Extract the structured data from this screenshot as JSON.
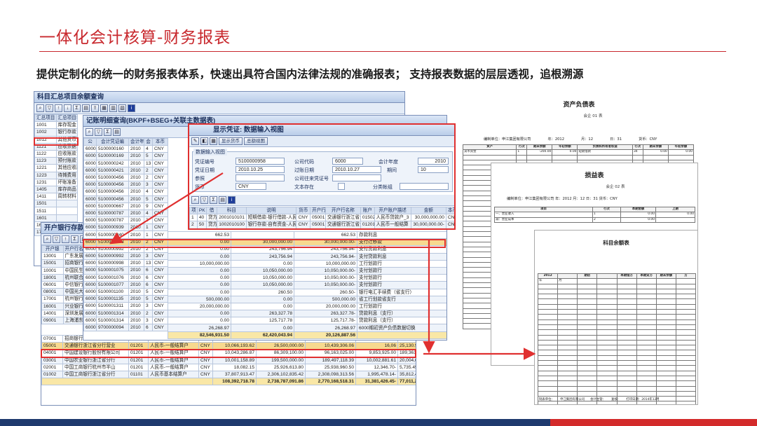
{
  "slide": {
    "title": "一体化会计核算-财务报表",
    "subtitle": "提供定制化的统一的财务报表体系，快速出具符合国内法律法规的准确报表； 支持报表数据的层层透视，追根溯源"
  },
  "colors": {
    "accent_red": "#c8282d",
    "sap_header": "#d6e1f1",
    "highlight": "#f7d98f",
    "footer_blue": "#1f3a6e",
    "footer_red": "#d32a2a"
  },
  "win1": {
    "title": "科目汇总项目余额查询",
    "headers": [
      "汇总项目",
      "汇总项目名"
    ],
    "rows": [
      [
        "1001",
        "库存现金"
      ],
      [
        "1002",
        "银行存款"
      ],
      [
        "1012",
        "其他货币资"
      ],
      [
        "1121",
        "应收票据"
      ],
      [
        "1122",
        "应收账款"
      ],
      [
        "1123",
        "预付账款"
      ],
      [
        "1221",
        "其他应收款"
      ],
      [
        "1223",
        "待摊费用"
      ],
      [
        "1231",
        "坏账准备"
      ],
      [
        "1405",
        "库存商品"
      ],
      [
        "1411",
        "周转材料"
      ],
      [
        "1501",
        ""
      ],
      [
        "1511",
        ""
      ],
      [
        "1601",
        ""
      ],
      [
        "1602",
        ""
      ],
      [
        "1701",
        ""
      ]
    ]
  },
  "win2": {
    "title": "记账明细查询(BKPF+BSEG+关联主数据表)",
    "headers": [
      "公",
      "会计凭证编",
      "会计年",
      "会",
      "本币"
    ],
    "rows": [
      [
        "6000",
        "5100000160",
        "2010",
        "4",
        "CNY"
      ],
      [
        "6000",
        "5100000169",
        "2010",
        "5",
        "CNY"
      ],
      [
        "6000",
        "5100000242",
        "2010",
        "13",
        "CNY"
      ],
      [
        "6000",
        "5100000421",
        "2010",
        "2",
        "CNY"
      ],
      [
        "6000",
        "5100000456",
        "2010",
        "2",
        "CNY"
      ],
      [
        "6000",
        "5100000456",
        "2010",
        "3",
        "CNY"
      ],
      [
        "6000",
        "5100000456",
        "2010",
        "4",
        "CNY"
      ],
      [
        "6000",
        "5100000456",
        "2010",
        "5",
        "CNY"
      ],
      [
        "6000",
        "5100000667",
        "2010",
        "9",
        "CNY"
      ],
      [
        "6000",
        "5100000787",
        "2010",
        "4",
        "CNY"
      ],
      [
        "6000",
        "5100000787",
        "2010",
        "3",
        "CNY"
      ],
      [
        "6000",
        "5100000939",
        "2010",
        "1",
        "CNY"
      ],
      [
        "6000",
        "5100000940",
        "2010",
        "1",
        "CNY"
      ],
      [
        "6000",
        "5100000958",
        "2010",
        "2",
        "CNY"
      ],
      [
        "6000",
        "5100000992",
        "2010",
        "2",
        "CNY"
      ],
      [
        "6000",
        "5100000992",
        "2010",
        "3",
        "CNY"
      ],
      [
        "6000",
        "5100000998",
        "2010",
        "13",
        "CNY"
      ],
      [
        "6000",
        "5100001075",
        "2010",
        "6",
        "CNY"
      ],
      [
        "6000",
        "5100001076",
        "2010",
        "6",
        "CNY"
      ],
      [
        "6000",
        "5100001077",
        "2010",
        "6",
        "CNY"
      ],
      [
        "6000",
        "5100001100",
        "2010",
        "5",
        "CNY"
      ],
      [
        "6000",
        "5100001135",
        "2010",
        "5",
        "CNY"
      ],
      [
        "6000",
        "5100001311",
        "2010",
        "3",
        "CNY"
      ],
      [
        "6000",
        "5100001314",
        "2010",
        "2",
        "CNY"
      ],
      [
        "6000",
        "5100001314",
        "2010",
        "3",
        "CNY"
      ],
      [
        "6000",
        "9700000094",
        "2010",
        "6",
        "CNY"
      ]
    ],
    "detail": [
      [
        "662.53",
        "",
        "662.53",
        "存款利息"
      ],
      [
        "0.00",
        "30,000,000.00",
        "30,000,000.00-",
        "支行迁移款"
      ],
      [
        "0.00",
        "243,756.94",
        "243,756.94-",
        "支付贷款利息"
      ],
      [
        "0.00",
        "243,756.94",
        "243,756.94-",
        "支付贷款利息"
      ],
      [
        "10,000,000.00",
        "0.00",
        "10,000,000.00",
        "工行划款行"
      ],
      [
        "0.00",
        "10,050,000.00",
        "10,050,000.00-",
        "支付划款行"
      ],
      [
        "0.00",
        "10,050,000.00",
        "10,050,000.00-",
        "支付划款行"
      ],
      [
        "0.00",
        "10,050,000.00",
        "10,050,000.00-",
        "支付划款行"
      ],
      [
        "0.00",
        "260.50",
        "260.50-",
        "银行电汇手续费（省支行）"
      ],
      [
        "500,000.00",
        "0.00",
        "500,000.00",
        "省工行划款省支行"
      ],
      [
        "20,000,000.00",
        "0.00",
        "20,000,000.00",
        "工行划款行"
      ],
      [
        "0.00",
        "263,327.78",
        "263,327.78-",
        "贷款利息（支行）"
      ],
      [
        "0.00",
        "125,717.78",
        "125,717.78-",
        "贷款利息（支行）"
      ],
      [
        "26,268.97",
        "0.00",
        "26,268.97",
        "6000期初资产负债数据切换"
      ]
    ],
    "detail_sum": [
      "82,546,931.50",
      "62,420,043.94",
      "20,126,887.56"
    ]
  },
  "win3": {
    "title": "开户银行存款",
    "headers": [
      "开户银",
      "开户行名"
    ],
    "rows": [
      [
        "13001",
        "广东发展"
      ],
      [
        "15001",
        "招商银行"
      ],
      [
        "10001",
        "中国民生"
      ],
      [
        "18001",
        "杭州联合"
      ],
      [
        "06001",
        "中信银行"
      ],
      [
        "08001",
        "中国光大"
      ],
      [
        "17001",
        "杭州银行"
      ],
      [
        "16001",
        "兴业银行"
      ],
      [
        "14001",
        "深圳发展"
      ],
      [
        "09001",
        "上海浦东"
      ]
    ],
    "bottom": [
      [
        "07001",
        "招商银行股份有限公司",
        "01201",
        "人民币-一般结算户",
        "CNY",
        "20,054,236.29",
        "22,455,684.73",
        "42,210,860.84",
        "19,755,176.11-",
        "299,160.18"
      ],
      [
        "05001",
        "交通银行浙江省分行营业",
        "01201",
        "人民币-一般结算户",
        "CNY",
        "10,066,193.62",
        "26,500,000.00",
        "10,439,306.06",
        "16,06",
        "25,130.97-"
      ],
      [
        "04001",
        "中国建设银行股份有限公司",
        "01201",
        "人民币-一般结算户",
        "CNY",
        "10,043,286.87",
        "86,309,100.00",
        "96,163,025.00",
        "9,853,925.00",
        "189,361.87"
      ],
      [
        "03001",
        "中国农业银行浙江省分行",
        "01201",
        "人民币-一般结算户",
        "CNY",
        "10,001,158.89",
        "199,500,000.00",
        "189,497,118.39",
        "10,002,881.61",
        "20,004,040.50"
      ],
      [
        "02001",
        "中国工商银行杭州市半山",
        "01201",
        "人民币-一般结算户",
        "CNY",
        "18,082.15",
        "25,926,613.80",
        "25,938,960.50",
        "12,346.70-",
        "5,735.45"
      ],
      [
        "01002",
        "中国工商银行浙江省分行",
        "01101",
        "人民币基本结算户",
        "CNY",
        "37,807,913.47",
        "2,306,102,835.42",
        "2,308,098,313.56",
        "1,995,478.14-",
        "35,812,435.33"
      ]
    ],
    "sum": [
      "108,392,718.78",
      "2,738,787,091.86",
      "2,770,168,518.31",
      "31,381,426.45-",
      "77,011,292.33"
    ]
  },
  "dialog": {
    "title": "显示凭证: 数据输入视图",
    "btn_tax": "显示货币",
    "btn_overview": "总额视图",
    "group": "数据输入视图",
    "labels": {
      "doc_no": "凭证编号",
      "company": "公司代码",
      "year": "会计年度",
      "doc_date": "凭证日期",
      "posting_date": "过账日期",
      "period": "期间",
      "reference": "参照",
      "cross_company": "公司往来凭证号",
      "currency": "货币",
      "text_exist": "文本存在",
      "ledger_group": "分类帐组"
    },
    "values": {
      "doc_no": "5100000958",
      "company": "6000",
      "year": "2010",
      "doc_date": "2010.10.25",
      "posting_date": "2010.10.27",
      "period": "10",
      "currency": "CNY"
    },
    "headers": [
      "项",
      "PK",
      "借",
      "科目",
      "说明",
      "货币",
      "开户行",
      "开户行名称",
      "账户",
      "开户账户描述",
      "金额",
      "本币"
    ],
    "lines": [
      [
        "1",
        "40",
        "贷方",
        "2001010101",
        "短期借款-银行借款-人民币",
        "CNY",
        "05001",
        "交通银行浙江省分",
        "01502",
        "人民币贷款户_3",
        "30,000,000.00",
        "CN"
      ],
      [
        "2",
        "50",
        "贷方",
        "1002010100",
        "银行存款-自有资金-人民币",
        "CNY",
        "05001",
        "交通银行浙江省分",
        "01201",
        "人民币一般结算",
        "30,000,000.00-",
        "CN"
      ]
    ]
  },
  "doc_balance": {
    "title": "资产负债表",
    "form_no": "会企 01 表",
    "meta": [
      "编制单位：申江集团有限公司",
      "年：2012",
      "月：12",
      "日：31",
      "货币：CNY"
    ],
    "headers": [
      "资产",
      "行次",
      "期末余额",
      "年初余额",
      "负债和所有者权益",
      "行次",
      "期末余额",
      "年初余额"
    ],
    "row1": [
      "货币资金",
      "1",
      "-200.00",
      "0.00",
      "短期借款",
      "34",
      "0.00",
      "0.00"
    ]
  },
  "doc_profit": {
    "title": "损益表",
    "form_no": "会企 02 表",
    "meta": "编制单位：申江集团有限公司   年：2012   月：12   日：31   货币：CNY",
    "headers": [
      "项目",
      "行次",
      "本期金额",
      "上期"
    ],
    "rows": [
      [
        "一、营业收入",
        "1",
        "0.00",
        "0.00"
      ],
      [
        "减：营业成本",
        "2",
        "0.00",
        ""
      ]
    ]
  },
  "doc_trial": {
    "title": "科目余额表",
    "headers": [
      "2012",
      "",
      "期初",
      "",
      "本期借方",
      "本期贷方",
      "期末余额",
      "方"
    ],
    "rows": [
      [
        "年",
        "月",
        "",
        "",
        "",
        "",
        "",
        ""
      ]
    ],
    "footer": [
      "制表单位：",
      "申江集团有限公司",
      "会计主管：",
      "复核：",
      "打印日期：2014年12月"
    ]
  }
}
